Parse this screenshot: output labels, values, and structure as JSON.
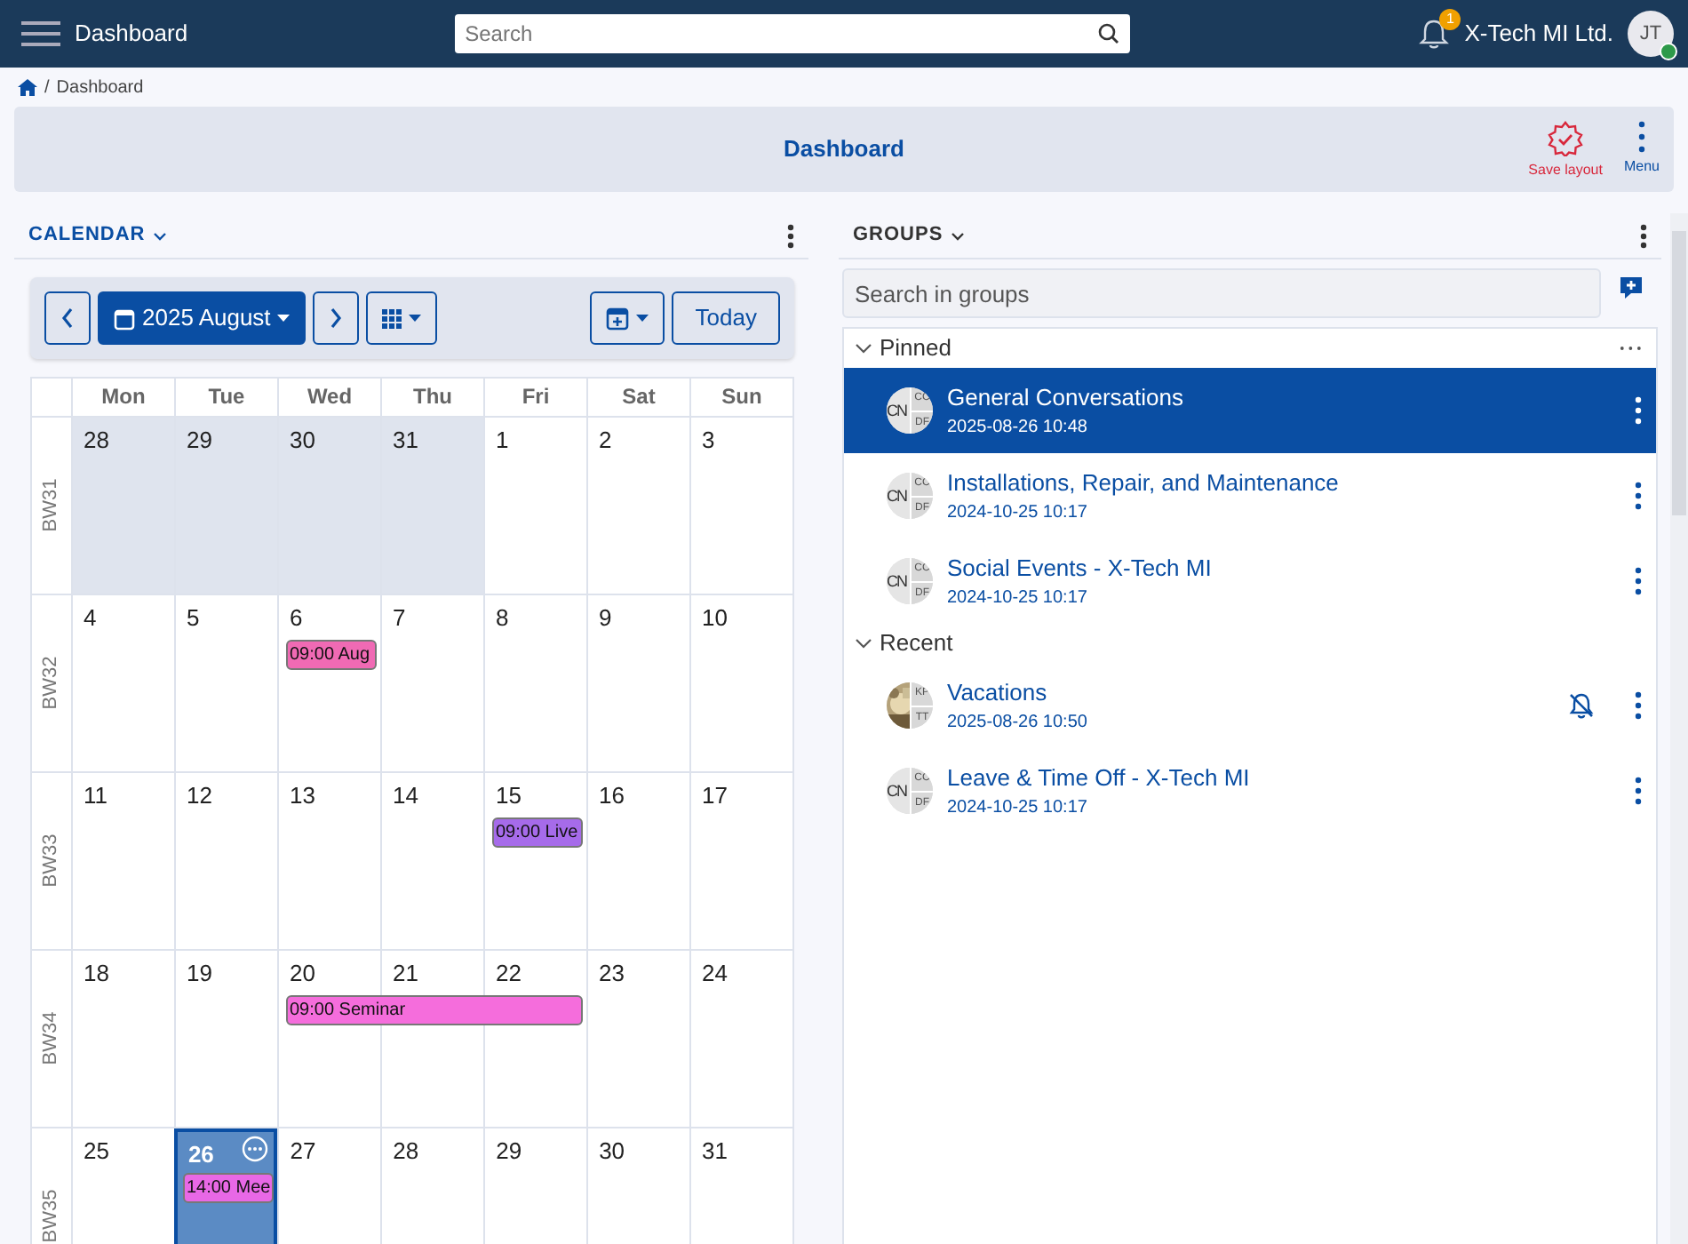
{
  "topbar": {
    "app_title": "Dashboard",
    "search": {
      "placeholder": "Search"
    },
    "notifications": "1",
    "organization": "X-Tech MI Ltd.",
    "user": {
      "initials": "JT",
      "online": true
    }
  },
  "breadcrumb": {
    "separator": "/",
    "items": [
      "Dashboard"
    ]
  },
  "page_bar": {
    "title": "Dashboard",
    "actions": [
      {
        "kind": "save",
        "label": "Save layout"
      },
      {
        "kind": "menu",
        "label": "Menu"
      }
    ]
  },
  "calendar": {
    "title": "CALENDAR",
    "month_label": "2025 August",
    "today_button": "Today",
    "weekdays": [
      "Mon",
      "Tue",
      "Wed",
      "Thu",
      "Fri",
      "Sat",
      "Sun"
    ],
    "weeks": [
      {
        "label": "BW31",
        "days": [
          {
            "day": "28",
            "in_month": false,
            "today": false
          },
          {
            "day": "29",
            "in_month": false,
            "today": false
          },
          {
            "day": "30",
            "in_month": false,
            "today": false
          },
          {
            "day": "31",
            "in_month": false,
            "today": false
          },
          {
            "day": "1",
            "in_month": true,
            "today": false
          },
          {
            "day": "2",
            "in_month": true,
            "today": false
          },
          {
            "day": "3",
            "in_month": true,
            "today": false
          }
        ]
      },
      {
        "label": "BW32",
        "days": [
          {
            "day": "4",
            "in_month": true,
            "today": false
          },
          {
            "day": "5",
            "in_month": true,
            "today": false
          },
          {
            "day": "6",
            "in_month": true,
            "today": false,
            "event": {
              "text": "09:00 Aug",
              "color": "#f06ab4"
            }
          },
          {
            "day": "7",
            "in_month": true,
            "today": false
          },
          {
            "day": "8",
            "in_month": true,
            "today": false
          },
          {
            "day": "9",
            "in_month": true,
            "today": false
          },
          {
            "day": "10",
            "in_month": true,
            "today": false
          }
        ]
      },
      {
        "label": "BW33",
        "days": [
          {
            "day": "11",
            "in_month": true,
            "today": false
          },
          {
            "day": "12",
            "in_month": true,
            "today": false
          },
          {
            "day": "13",
            "in_month": true,
            "today": false
          },
          {
            "day": "14",
            "in_month": true,
            "today": false
          },
          {
            "day": "15",
            "in_month": true,
            "today": false,
            "event": {
              "text": "09:00 Live",
              "color": "#a66bea"
            }
          },
          {
            "day": "16",
            "in_month": true,
            "today": false
          },
          {
            "day": "17",
            "in_month": true,
            "today": false
          }
        ]
      },
      {
        "label": "BW34",
        "days": [
          {
            "day": "18",
            "in_month": true,
            "today": false
          },
          {
            "day": "19",
            "in_month": true,
            "today": false
          },
          {
            "day": "20",
            "in_month": true,
            "today": false,
            "event": {
              "text": "09:00 Seminar",
              "color": "#f56ddc"
            }
          },
          {
            "day": "21",
            "in_month": true,
            "today": false,
            "event_continues": true
          },
          {
            "day": "22",
            "in_month": true,
            "today": false,
            "event_continues": true
          },
          {
            "day": "23",
            "in_month": true,
            "today": false
          },
          {
            "day": "24",
            "in_month": true,
            "today": false
          }
        ]
      },
      {
        "label": "BW35",
        "days": [
          {
            "day": "25",
            "in_month": true,
            "today": false
          },
          {
            "day": "26",
            "in_month": true,
            "today": true,
            "event": {
              "text": "14:00 Mee",
              "color": "#e868e6"
            }
          },
          {
            "day": "27",
            "in_month": true,
            "today": false
          },
          {
            "day": "28",
            "in_month": true,
            "today": false
          },
          {
            "day": "29",
            "in_month": true,
            "today": false
          },
          {
            "day": "30",
            "in_month": true,
            "today": false
          },
          {
            "day": "31",
            "in_month": true,
            "today": false
          }
        ]
      }
    ]
  },
  "groups": {
    "title": "GROUPS",
    "search": {
      "placeholder": "Search in groups"
    },
    "sections": [
      {
        "title": "Pinned",
        "expanded": true,
        "items": [
          {
            "name": "General Conversations",
            "date": "2025-08-26 10:48",
            "selected": true,
            "muted": false,
            "avatar": {
              "kind": "initials",
              "main": "CN",
              "top": "CC",
              "bottom": "DF"
            }
          },
          {
            "name": "Installations, Repair, and Maintenance",
            "date": "2024-10-25 10:17",
            "selected": false,
            "muted": false,
            "avatar": {
              "kind": "initials",
              "main": "CN",
              "top": "CC",
              "bottom": "DF"
            }
          },
          {
            "name": "Social Events - X-Tech MI",
            "date": "2024-10-25 10:17",
            "selected": false,
            "muted": false,
            "avatar": {
              "kind": "initials",
              "main": "CN",
              "top": "CC",
              "bottom": "DF"
            }
          }
        ]
      },
      {
        "title": "Recent",
        "expanded": true,
        "items": [
          {
            "name": "Vacations",
            "date": "2025-08-26 10:50",
            "selected": false,
            "muted": true,
            "avatar": {
              "kind": "picture",
              "top": "KP",
              "bottom": "TT"
            }
          },
          {
            "name": "Leave & Time Off - X-Tech MI",
            "date": "2024-10-25 10:17",
            "selected": false,
            "muted": false,
            "avatar": {
              "kind": "initials",
              "main": "CN",
              "top": "CC",
              "bottom": "DF"
            }
          }
        ]
      }
    ]
  }
}
